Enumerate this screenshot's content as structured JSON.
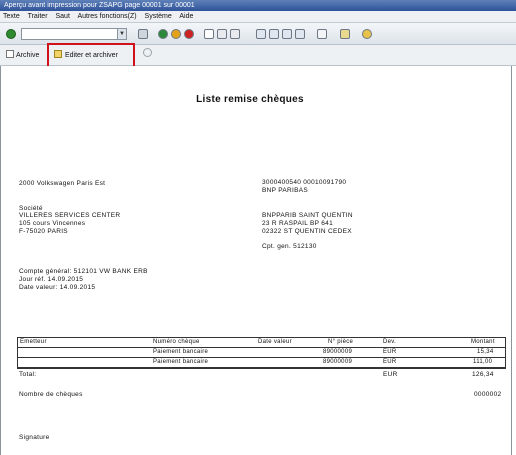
{
  "window": {
    "title": "Aperçu avant impression pour ZSAPG page 00001 sur 00001"
  },
  "menu": [
    "Texte",
    "Traiter",
    "Saut",
    "Autres fonctions(Z)",
    "Système",
    "Aide"
  ],
  "app_toolbar": {
    "archive_label": "Archive",
    "edit_archive_label": "Editer et archiver"
  },
  "doc": {
    "title": "Liste  remise chèques",
    "company": "2000  Volkswagen  Paris  Est",
    "account_number": "3000400540  00010091790",
    "bank_name": "BNP  PARIBAS",
    "society_label": "Société",
    "society_lines": [
      "VILLERES   SERVICES   CENTER",
      "105  cours  Vincennes",
      "F-75020    PARIS"
    ],
    "bank_lines": [
      "BNPPARIB   SAINT   QUENTIN",
      "23 R RASPAIL                    BP  641",
      "02322   ST  QUENTIN  CEDEX"
    ],
    "cpt": "Cpt.    gen. 512130",
    "compte_general": "Compte  général:   512101  VW  BANK  ERB",
    "jour_ref": "Jour  réf.       14.09.2015",
    "date_valeur": "Date  valeur: 14.09.2015",
    "table": {
      "headers": [
        "Emetteur",
        "Numéro   chèque",
        "Date  valeur",
        "N° pièce",
        "Dev.",
        "Montant"
      ],
      "rows": [
        [
          "",
          "Paiement   bancaire",
          "",
          "89000009",
          "EUR",
          "15,34"
        ],
        [
          "",
          "Paiement   bancaire",
          "",
          "89000009",
          "EUR",
          "111,00"
        ]
      ],
      "total_label": "Total:",
      "total_currency": "EUR",
      "total_amount": "126,34"
    },
    "cheques_label": "Nombre  de  chèques",
    "cheques_count": "0000002",
    "signature_label": "Signature"
  }
}
